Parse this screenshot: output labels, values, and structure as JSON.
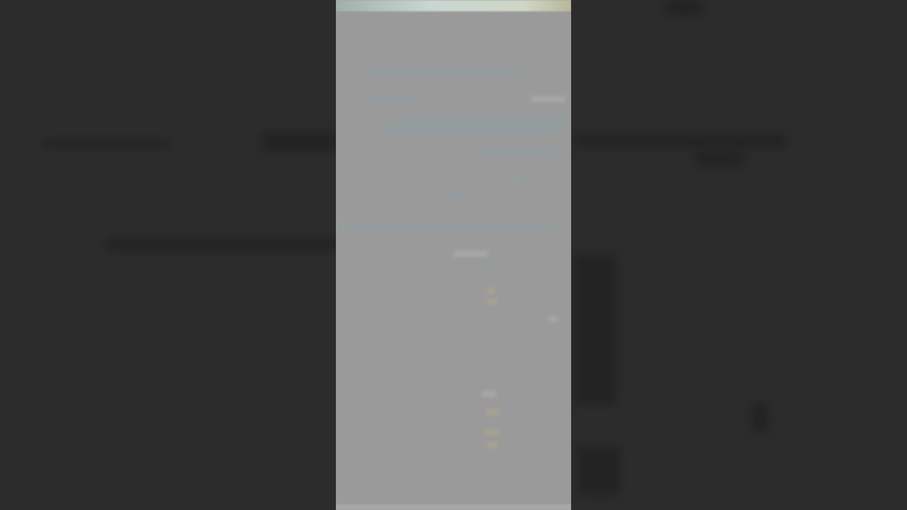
{
  "screen": {
    "description_hidden": "",
    "status_colors": {
      "background": "#2c2c2c",
      "phone_screen": "#9a9a9a"
    }
  }
}
